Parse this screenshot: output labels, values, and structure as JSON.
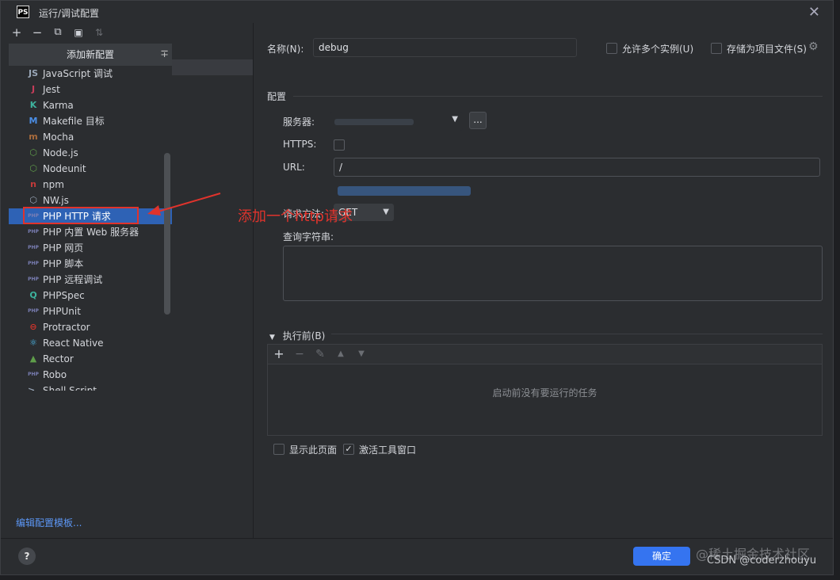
{
  "window": {
    "app_icon": "PS",
    "title": "运行/调试配置",
    "close_icon": "close-icon"
  },
  "left_toolbar": {
    "add": "+",
    "remove": "−",
    "copy": "⧉",
    "folder": "▣",
    "sort": "⇅"
  },
  "add_config_panel": {
    "title": "添加新配置",
    "collapse_icon": "collapse-all-icon"
  },
  "config_types": [
    {
      "label": "JavaScript 调试",
      "icon": "javascript-debug-icon",
      "color": "#9aa7b8",
      "glyph": "JS"
    },
    {
      "label": "Jest",
      "icon": "jest-icon",
      "color": "#c63d5a",
      "glyph": "J"
    },
    {
      "label": "Karma",
      "icon": "karma-icon",
      "color": "#3db39e",
      "glyph": "K"
    },
    {
      "label": "Makefile 目标",
      "icon": "makefile-icon",
      "color": "#4b8ee6",
      "glyph": "M"
    },
    {
      "label": "Mocha",
      "icon": "mocha-icon",
      "color": "#a86b3c",
      "glyph": "m"
    },
    {
      "label": "Node.js",
      "icon": "nodejs-icon",
      "color": "#5f9e4a",
      "glyph": "⬡"
    },
    {
      "label": "Nodeunit",
      "icon": "nodeunit-icon",
      "color": "#5f9e4a",
      "glyph": "⬡"
    },
    {
      "label": "npm",
      "icon": "npm-icon",
      "color": "#c53a3a",
      "glyph": "n"
    },
    {
      "label": "NW.js",
      "icon": "nwjs-icon",
      "color": "#9aa7b8",
      "glyph": "⬡"
    },
    {
      "label": "PHP HTTP 请求",
      "icon": "php-http-request-icon",
      "color": "#7b7fb5",
      "glyph": "PHP"
    },
    {
      "label": "PHP 内置 Web 服务器",
      "icon": "php-builtin-server-icon",
      "color": "#7b7fb5",
      "glyph": "PHP"
    },
    {
      "label": "PHP 网页",
      "icon": "php-webpage-icon",
      "color": "#7b7fb5",
      "glyph": "PHP"
    },
    {
      "label": "PHP 脚本",
      "icon": "php-script-icon",
      "color": "#7b7fb5",
      "glyph": "PHP"
    },
    {
      "label": "PHP 远程调试",
      "icon": "php-remote-debug-icon",
      "color": "#7b7fb5",
      "glyph": "PHP"
    },
    {
      "label": "PHPSpec",
      "icon": "phpspec-icon",
      "color": "#3db39e",
      "glyph": "Q"
    },
    {
      "label": "PHPUnit",
      "icon": "phpunit-icon",
      "color": "#7b7fb5",
      "glyph": "PHP"
    },
    {
      "label": "Protractor",
      "icon": "protractor-icon",
      "color": "#d0342c",
      "glyph": "⊖"
    },
    {
      "label": "React Native",
      "icon": "react-native-icon",
      "color": "#4fc3f7",
      "glyph": "⚛"
    },
    {
      "label": "Rector",
      "icon": "rector-icon",
      "color": "#5f9e4a",
      "glyph": "▲"
    },
    {
      "label": "Robo",
      "icon": "robo-icon",
      "color": "#7b7fb5",
      "glyph": "PHP"
    },
    {
      "label": "Shell Script",
      "icon": "shell-script-icon",
      "color": "#9aa7b8",
      "glyph": ">_"
    }
  ],
  "selected_index": 9,
  "edit_templates_link": "编辑配置模板...",
  "help_button": "?",
  "form": {
    "name_label": "名称(N):",
    "name_value": "debug",
    "allow_parallel_label": "允许多个实例(U)",
    "store_as_project_label": "存储为项目文件(S)",
    "gear_icon": "gear-icon",
    "config_section": "配置",
    "server_label": "服务器:",
    "server_browse": "...",
    "https_label": "HTTPS:",
    "url_label": "URL:",
    "url_value": "/",
    "method_label": "请求方法:",
    "method_value": "GET",
    "query_label": "查询字符串:",
    "query_value": ""
  },
  "before_launch": {
    "title": "执行前(B)",
    "add": "+",
    "remove": "−",
    "edit": "✎",
    "up": "▲",
    "down": "▼",
    "empty_message": "启动前没有要运行的任务"
  },
  "bottom_checks": {
    "show_page_label": "显示此页面",
    "show_page_checked": false,
    "activate_tool_label": "激活工具窗口",
    "activate_tool_checked": true
  },
  "footer": {
    "ok_label": "确定"
  },
  "annotation": {
    "text": "添加一个http请求",
    "color": "#e0332c"
  },
  "watermark": {
    "line1": "@稀土掘金技术社区",
    "line2": "CSDN @coderzhouyu"
  },
  "colors": {
    "accent": "#3574f0",
    "selection": "#2e62b5",
    "link": "#5c97f5",
    "annotation": "#e0332c"
  }
}
